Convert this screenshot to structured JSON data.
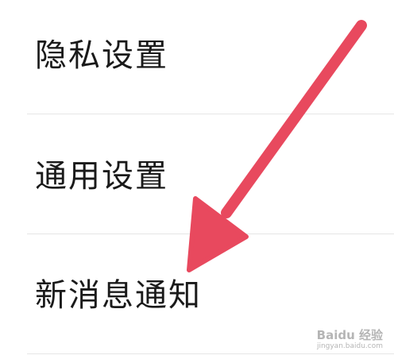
{
  "settings": {
    "items": [
      {
        "label": "隐私设置"
      },
      {
        "label": "通用设置"
      },
      {
        "label": "新消息通知"
      }
    ]
  },
  "annotation": {
    "arrow_color": "#e8495e"
  },
  "watermark": {
    "logo": "Baidu 经验",
    "url": "jingyan.baidu.com"
  }
}
